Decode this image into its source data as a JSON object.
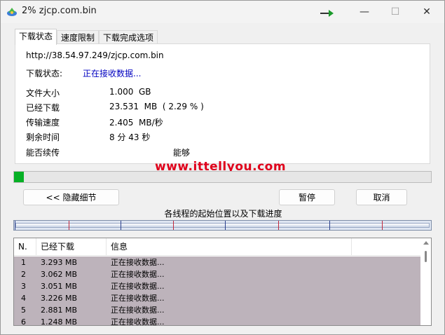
{
  "window": {
    "title": "2% zjcp.com.bin",
    "minimize_glyph": "—",
    "maximize_glyph": "☐",
    "close_glyph": "✕"
  },
  "tabs": [
    {
      "label": "下载状态",
      "active": true
    },
    {
      "label": "速度限制",
      "active": false
    },
    {
      "label": "下载完成选项",
      "active": false
    }
  ],
  "status": {
    "url": "http://38.54.97.249/zjcp.com.bin",
    "label": "下载状态:",
    "value": "正在接收数据...",
    "rows": [
      {
        "key": "文件大小",
        "value": "1.000  GB"
      },
      {
        "key": "已经下载",
        "value": "23.531  MB  ( 2.29 % )"
      },
      {
        "key": "传输速度",
        "value": "2.405  MB/秒"
      },
      {
        "key": "剩余时间",
        "value": "8 分 43 秒"
      },
      {
        "key": "能否续传",
        "value": "能够"
      }
    ]
  },
  "progress": {
    "percent": 2.29
  },
  "watermark": "www.ittellyou.com",
  "buttons": {
    "hide_details": "<< 隐藏细节",
    "pause": "暂停",
    "cancel": "取消"
  },
  "segments": {
    "caption": "各线程的起始位置以及下载进度",
    "fraction_positions": [
      0.0,
      0.13,
      0.253,
      0.38,
      0.505,
      0.632,
      0.755,
      0.88
    ]
  },
  "threads_table": {
    "columns": [
      "N.",
      "已经下载",
      "信息",
      ""
    ],
    "rows": [
      {
        "n": "1",
        "downloaded": "3.293 MB",
        "info": "正在接收数据..."
      },
      {
        "n": "2",
        "downloaded": "3.062 MB",
        "info": "正在接收数据..."
      },
      {
        "n": "3",
        "downloaded": "3.051 MB",
        "info": "正在接收数据..."
      },
      {
        "n": "4",
        "downloaded": "3.226 MB",
        "info": "正在接收数据..."
      },
      {
        "n": "5",
        "downloaded": "2.881 MB",
        "info": "正在接收数据..."
      },
      {
        "n": "6",
        "downloaded": "1.248 MB",
        "info": "正在接收数据..."
      }
    ]
  },
  "colors": {
    "progress_fill": "#06b025",
    "status_value": "#0000c0",
    "watermark": "#e0001b",
    "row_highlight": "#bdb3bb",
    "segment_mark_odd": "#c0283c",
    "segment_mark_even": "#2a3f8c"
  }
}
